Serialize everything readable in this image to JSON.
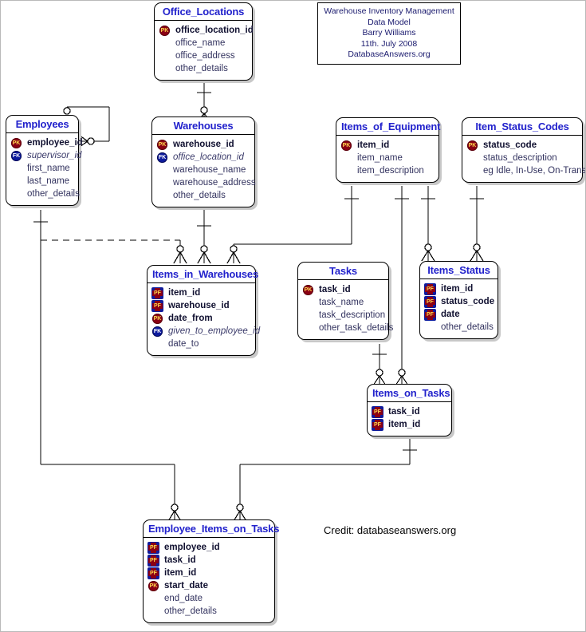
{
  "diagram": {
    "title_box": {
      "lines": [
        "Warehouse Inventory Management",
        "Data Model",
        "Barry Williams",
        "11th. July 2008",
        "DatabaseAnswers.org"
      ]
    },
    "credit": "Credit: databaseanswers.org",
    "colors": {
      "entity_title": "#2222cc",
      "pk_badge": "#8b0014",
      "fk_badge": "#0d1b9e",
      "badge_text": "#ffd84d",
      "line": "#000000",
      "shadow": "#c8c8c8"
    },
    "entities": [
      {
        "id": "office_locations",
        "name": "Office_Locations",
        "attributes": [
          {
            "badge": "PK",
            "name": "office_location_id"
          },
          {
            "badge": "",
            "name": "office_name"
          },
          {
            "badge": "",
            "name": "office_address"
          },
          {
            "badge": "",
            "name": "other_details"
          }
        ]
      },
      {
        "id": "employees",
        "name": "Employees",
        "attributes": [
          {
            "badge": "PK",
            "name": "employee_id"
          },
          {
            "badge": "FK",
            "name": "supervisor_id"
          },
          {
            "badge": "",
            "name": "first_name"
          },
          {
            "badge": "",
            "name": "last_name"
          },
          {
            "badge": "",
            "name": "other_details"
          }
        ]
      },
      {
        "id": "warehouses",
        "name": "Warehouses",
        "attributes": [
          {
            "badge": "PK",
            "name": "warehouse_id"
          },
          {
            "badge": "FK",
            "name": "office_location_id"
          },
          {
            "badge": "",
            "name": "warehouse_name"
          },
          {
            "badge": "",
            "name": "warehouse_address"
          },
          {
            "badge": "",
            "name": "other_details"
          }
        ]
      },
      {
        "id": "items_of_equipment",
        "name": "Items_of_Equipment",
        "attributes": [
          {
            "badge": "PK",
            "name": "item_id"
          },
          {
            "badge": "",
            "name": "item_name"
          },
          {
            "badge": "",
            "name": "item_description"
          }
        ]
      },
      {
        "id": "item_status_codes",
        "name": "Item_Status_Codes",
        "attributes": [
          {
            "badge": "PK",
            "name": "status_code"
          },
          {
            "badge": "",
            "name": "status_description"
          },
          {
            "badge": "",
            "name": "eg Idle, In-Use, On-Transit"
          }
        ]
      },
      {
        "id": "items_in_warehouses",
        "name": "Items_in_Warehouses",
        "attributes": [
          {
            "badge": "PF",
            "name": "item_id"
          },
          {
            "badge": "PF",
            "name": "warehouse_id"
          },
          {
            "badge": "PK",
            "name": "date_from"
          },
          {
            "badge": "FK",
            "name": "given_to_employee_id"
          },
          {
            "badge": "",
            "name": "date_to"
          }
        ]
      },
      {
        "id": "tasks",
        "name": "Tasks",
        "attributes": [
          {
            "badge": "PK",
            "name": "task_id"
          },
          {
            "badge": "",
            "name": "task_name"
          },
          {
            "badge": "",
            "name": "task_description"
          },
          {
            "badge": "",
            "name": "other_task_details"
          }
        ]
      },
      {
        "id": "items_status",
        "name": "Items_Status",
        "attributes": [
          {
            "badge": "PF",
            "name": "item_id"
          },
          {
            "badge": "PF",
            "name": "status_code"
          },
          {
            "badge": "PF",
            "name": "date"
          },
          {
            "badge": "",
            "name": "other_details"
          }
        ]
      },
      {
        "id": "items_on_tasks",
        "name": "Items_on_Tasks",
        "attributes": [
          {
            "badge": "PF",
            "name": "task_id"
          },
          {
            "badge": "PF",
            "name": "item_id"
          }
        ]
      },
      {
        "id": "employee_items_on_tasks",
        "name": "Employee_Items_on_Tasks",
        "attributes": [
          {
            "badge": "PF",
            "name": "employee_id"
          },
          {
            "badge": "PF",
            "name": "task_id"
          },
          {
            "badge": "PF",
            "name": "item_id"
          },
          {
            "badge": "PK",
            "name": "start_date"
          },
          {
            "badge": "",
            "name": "end_date"
          },
          {
            "badge": "",
            "name": "other_details"
          }
        ]
      }
    ],
    "relationships": [
      {
        "from": "office_locations",
        "to": "warehouses",
        "type": "one-to-many"
      },
      {
        "from": "employees",
        "to": "employees",
        "type": "self-referencing supervisor"
      },
      {
        "from": "employees",
        "to": "items_in_warehouses",
        "type": "one-to-many (dashed)"
      },
      {
        "from": "warehouses",
        "to": "items_in_warehouses",
        "type": "one-to-many"
      },
      {
        "from": "items_of_equipment",
        "to": "items_in_warehouses",
        "type": "one-to-many"
      },
      {
        "from": "items_of_equipment",
        "to": "items_status",
        "type": "one-to-many"
      },
      {
        "from": "items_of_equipment",
        "to": "items_on_tasks",
        "type": "one-to-many"
      },
      {
        "from": "item_status_codes",
        "to": "items_status",
        "type": "one-to-many"
      },
      {
        "from": "tasks",
        "to": "items_on_tasks",
        "type": "one-to-many"
      },
      {
        "from": "employees",
        "to": "employee_items_on_tasks",
        "type": "one-to-many"
      },
      {
        "from": "items_on_tasks",
        "to": "employee_items_on_tasks",
        "type": "one-to-many"
      }
    ]
  }
}
